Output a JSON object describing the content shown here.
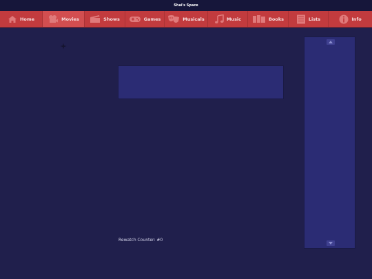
{
  "window": {
    "title": "Shai's Space"
  },
  "nav": {
    "items": [
      {
        "label": "Home",
        "icon": "home-icon"
      },
      {
        "label": "Movies",
        "icon": "film-reel-icon"
      },
      {
        "label": "Shows",
        "icon": "clapperboard-icon"
      },
      {
        "label": "Games",
        "icon": "gamepad-icon"
      },
      {
        "label": "Musicals",
        "icon": "theater-masks-icon"
      },
      {
        "label": "Music",
        "icon": "music-note-icon"
      },
      {
        "label": "Books",
        "icon": "books-icon"
      },
      {
        "label": "Lists",
        "icon": "list-icon"
      },
      {
        "label": "Info",
        "icon": "info-icon"
      }
    ],
    "active_index": 1
  },
  "main": {
    "counter_label": "Rewatch Counter:",
    "counter_value": "#0"
  },
  "colors": {
    "background": "#201f4c",
    "navbar": "#c23b3e",
    "panel": "#2b2c74"
  }
}
